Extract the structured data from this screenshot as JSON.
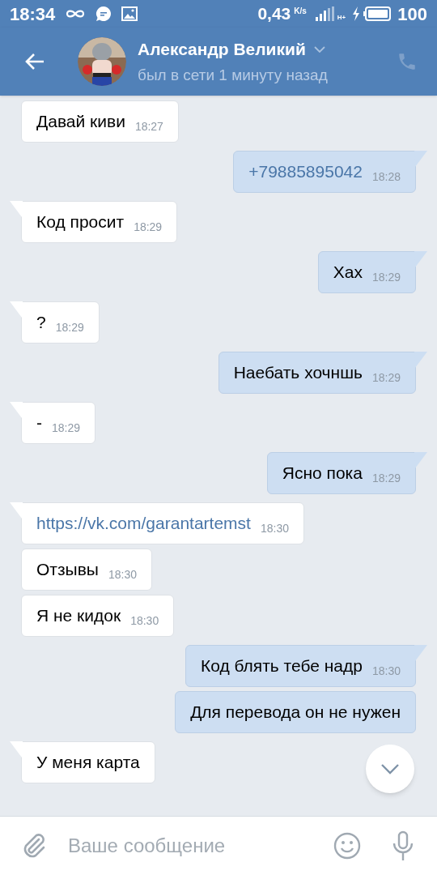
{
  "status_bar": {
    "time": "18:34",
    "speed": "0,43",
    "speed_unit": "K/s",
    "network": "H+",
    "battery": "100"
  },
  "header": {
    "name": "Александр Великий",
    "status": "был в сети 1 минуту назад"
  },
  "messages": [
    {
      "outgoing": false,
      "tail": false,
      "link": false,
      "text": "Давай киви",
      "time": "18:27"
    },
    {
      "outgoing": true,
      "tail": true,
      "link": true,
      "text": "+79885895042",
      "time": "18:28"
    },
    {
      "outgoing": false,
      "tail": true,
      "link": false,
      "text": "Код просит",
      "time": "18:29"
    },
    {
      "outgoing": true,
      "tail": true,
      "link": false,
      "text": "Хах",
      "time": "18:29"
    },
    {
      "outgoing": false,
      "tail": true,
      "link": false,
      "text": "?",
      "time": "18:29"
    },
    {
      "outgoing": true,
      "tail": true,
      "link": false,
      "text": "Наебать хочншь",
      "time": "18:29"
    },
    {
      "outgoing": false,
      "tail": true,
      "link": false,
      "text": "-",
      "time": "18:29"
    },
    {
      "outgoing": true,
      "tail": true,
      "link": false,
      "text": "Ясно пока",
      "time": "18:29"
    },
    {
      "outgoing": false,
      "tail": true,
      "link": true,
      "text": "https://vk.com/garantartemst",
      "time": "18:30"
    },
    {
      "outgoing": false,
      "tail": false,
      "link": false,
      "text": "Отзывы",
      "time": "18:30"
    },
    {
      "outgoing": false,
      "tail": false,
      "link": false,
      "text": "Я не кидок",
      "time": "18:30"
    },
    {
      "outgoing": true,
      "tail": true,
      "link": false,
      "text": "Код блять тебе надр",
      "time": "18:30"
    },
    {
      "outgoing": true,
      "tail": false,
      "link": false,
      "text": "Для перевода он не нужен"
    },
    {
      "outgoing": false,
      "tail": true,
      "link": false,
      "text": "У меня карта"
    }
  ],
  "composer": {
    "placeholder": "Ваше сообщение"
  }
}
